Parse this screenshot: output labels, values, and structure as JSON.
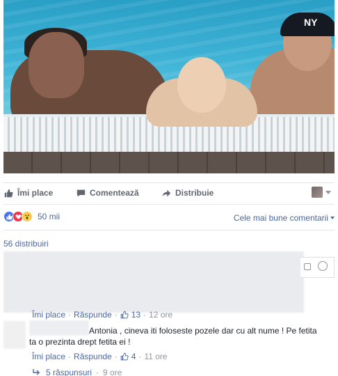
{
  "actions": {
    "like_label": "Îmi place",
    "comment_label": "Comentează",
    "share_label": "Distribuie"
  },
  "photo": {
    "cap_logo": "NY"
  },
  "reactions": {
    "count": "50 mii",
    "sort_label": "Cele mai bune comentarii"
  },
  "shares": {
    "label": "56 distribuiri"
  },
  "comments": [
    {
      "like_label": "Îmi place",
      "reply_label": "Răspunde",
      "likes": "13",
      "time": "12 ore"
    },
    {
      "text_line1": "Antonia , cineva iti foloseste pozele dar cu alt nume ! Pe fetita",
      "text_line2": "ta o prezinta drept fetita ei !",
      "like_label": "Îmi place",
      "reply_label": "Răspunde",
      "likes": "4",
      "time": "11 ore",
      "replies_label": "5 răspunsuri",
      "replies_time": "9 ore"
    }
  ],
  "colors": {
    "link": "#4b67a1",
    "muted": "#90949c",
    "action_text": "#616770"
  },
  "icons": {
    "like": "thumbs-up-icon",
    "comment": "speech-bubble-icon",
    "share": "share-arrow-icon",
    "camera": "camera-icon",
    "emoji": "smiley-icon",
    "reply": "reply-arrow-icon"
  }
}
